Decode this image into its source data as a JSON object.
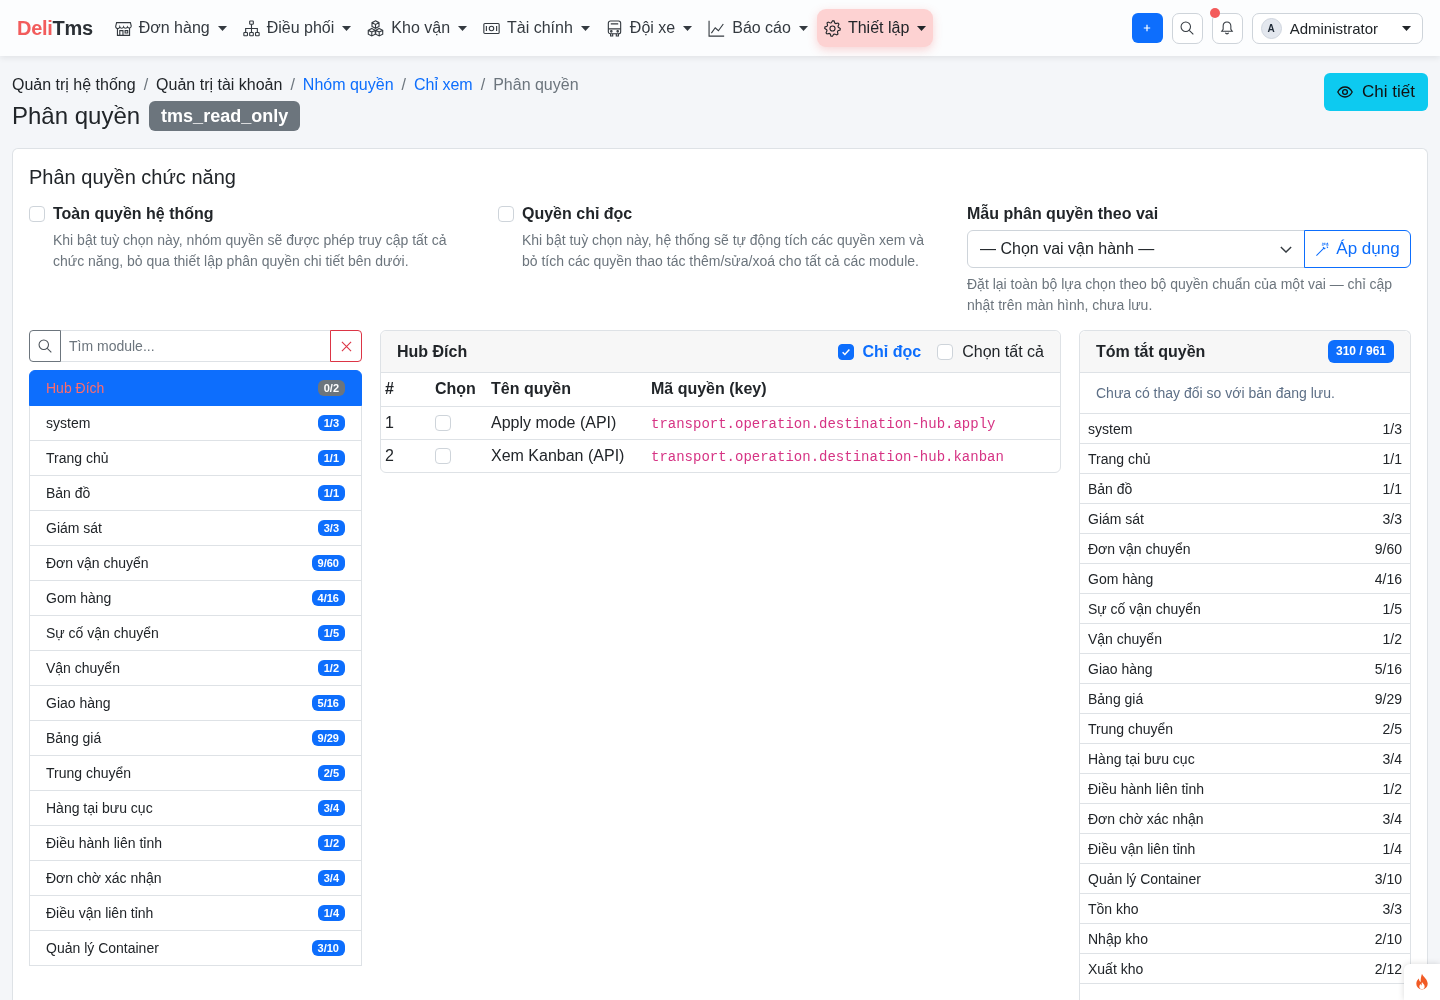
{
  "navbar": {
    "brand": {
      "accent": "Deli",
      "rest": "Tms"
    },
    "menu": [
      {
        "label": "Đơn hàng",
        "selected": false
      },
      {
        "label": "Điều phối",
        "selected": false
      },
      {
        "label": "Kho vận",
        "selected": false
      },
      {
        "label": "Tài chính",
        "selected": false
      },
      {
        "label": "Đội xe",
        "selected": false
      },
      {
        "label": "Báo cáo",
        "selected": false
      },
      {
        "label": "Thiết lập",
        "selected": true
      }
    ],
    "notifications": {
      "unread": true
    },
    "user": {
      "initial": "A",
      "name": "Administrator"
    }
  },
  "breadcrumb": {
    "separator": "/",
    "items": [
      {
        "label": "Quản trị hệ thống",
        "kind": "plain"
      },
      {
        "label": "Quản trị tài khoản",
        "kind": "plain"
      },
      {
        "label": "Nhóm quyền",
        "kind": "link"
      },
      {
        "label": "Chỉ xem",
        "kind": "link"
      },
      {
        "label": "Phân quyền",
        "kind": "current"
      }
    ]
  },
  "page": {
    "title": "Phân quyền",
    "role_badge": "tms_read_only",
    "detail_button": "Chi tiết"
  },
  "permissions_card": {
    "title": "Phân quyền chức năng",
    "options": [
      {
        "label": "Toàn quyền hệ thống",
        "description": "Khi bật tuỳ chọn này, nhóm quyền sẽ được phép truy cập tất cả chức năng, bỏ qua thiết lập phân quyền chi tiết bên dưới.",
        "checked": false
      },
      {
        "label": "Quyền chỉ đọc",
        "description": "Khi bật tuỳ chọn này, hệ thống sẽ tự động tích các quyền xem và bỏ tích các quyền thao tác thêm/sửa/xoá cho tất cả các module.",
        "checked": false
      }
    ],
    "role_template": {
      "label": "Mẫu phân quyền theo vai",
      "select_value": "— Chọn vai vận hành —",
      "apply_button": "Áp dụng",
      "help": "Đặt lại toàn bộ lựa chọn theo bộ quyền chuẩn của một vai — chỉ cập nhật trên màn hình, chưa lưu."
    }
  },
  "modules": {
    "search": {
      "placeholder": "Tìm module..."
    },
    "items": [
      {
        "name": "Hub Đích",
        "count": "0/2",
        "selected": true
      },
      {
        "name": "system",
        "count": "1/3",
        "selected": false
      },
      {
        "name": "Trang chủ",
        "count": "1/1",
        "selected": false
      },
      {
        "name": "Bản đồ",
        "count": "1/1",
        "selected": false
      },
      {
        "name": "Giám sát",
        "count": "3/3",
        "selected": false
      },
      {
        "name": "Đơn vận chuyển",
        "count": "9/60",
        "selected": false
      },
      {
        "name": "Gom hàng",
        "count": "4/16",
        "selected": false
      },
      {
        "name": "Sự cố vận chuyển",
        "count": "1/5",
        "selected": false
      },
      {
        "name": "Vận chuyển",
        "count": "1/2",
        "selected": false
      },
      {
        "name": "Giao hàng",
        "count": "5/16",
        "selected": false
      },
      {
        "name": "Bảng giá",
        "count": "9/29",
        "selected": false
      },
      {
        "name": "Trung chuyển",
        "count": "2/5",
        "selected": false
      },
      {
        "name": "Hàng tại bưu cục",
        "count": "3/4",
        "selected": false
      },
      {
        "name": "Điều hành liên tỉnh",
        "count": "1/2",
        "selected": false
      },
      {
        "name": "Đơn chờ xác nhận",
        "count": "3/4",
        "selected": false
      },
      {
        "name": "Điều vận liên tỉnh",
        "count": "1/4",
        "selected": false
      },
      {
        "name": "Quản lý Container",
        "count": "3/10",
        "selected": false
      }
    ]
  },
  "module_detail": {
    "title": "Hub Đích",
    "read_only": {
      "label": "Chỉ đọc",
      "checked": true
    },
    "select_all": {
      "label": "Chọn tất cả",
      "checked": false
    },
    "columns": [
      "#",
      "Chọn",
      "Tên quyền",
      "Mã quyền (key)"
    ],
    "rows": [
      {
        "index": "1",
        "checked": false,
        "name": "Apply mode (API)",
        "key": "transport.operation.destination-hub.apply"
      },
      {
        "index": "2",
        "checked": false,
        "name": "Xem Kanban (API)",
        "key": "transport.operation.destination-hub.kanban"
      }
    ]
  },
  "summary": {
    "title": "Tóm tắt quyền",
    "total": "310 / 961",
    "note": "Chưa có thay đổi so với bản đang lưu.",
    "rows": [
      {
        "name": "system",
        "count": "1/3"
      },
      {
        "name": "Trang chủ",
        "count": "1/1"
      },
      {
        "name": "Bản đồ",
        "count": "1/1"
      },
      {
        "name": "Giám sát",
        "count": "3/3"
      },
      {
        "name": "Đơn vận chuyển",
        "count": "9/60"
      },
      {
        "name": "Gom hàng",
        "count": "4/16"
      },
      {
        "name": "Sự cố vận chuyển",
        "count": "1/5"
      },
      {
        "name": "Vận chuyển",
        "count": "1/2"
      },
      {
        "name": "Giao hàng",
        "count": "5/16"
      },
      {
        "name": "Bảng giá",
        "count": "9/29"
      },
      {
        "name": "Trung chuyển",
        "count": "2/5"
      },
      {
        "name": "Hàng tại bưu cục",
        "count": "3/4"
      },
      {
        "name": "Điều hành liên tỉnh",
        "count": "1/2"
      },
      {
        "name": "Đơn chờ xác nhận",
        "count": "3/4"
      },
      {
        "name": "Điều vận liên tỉnh",
        "count": "1/4"
      },
      {
        "name": "Quản lý Container",
        "count": "3/10"
      },
      {
        "name": "Tồn kho",
        "count": "3/3"
      },
      {
        "name": "Nhập kho",
        "count": "2/10"
      },
      {
        "name": "Xuất kho",
        "count": "2/12"
      }
    ]
  }
}
